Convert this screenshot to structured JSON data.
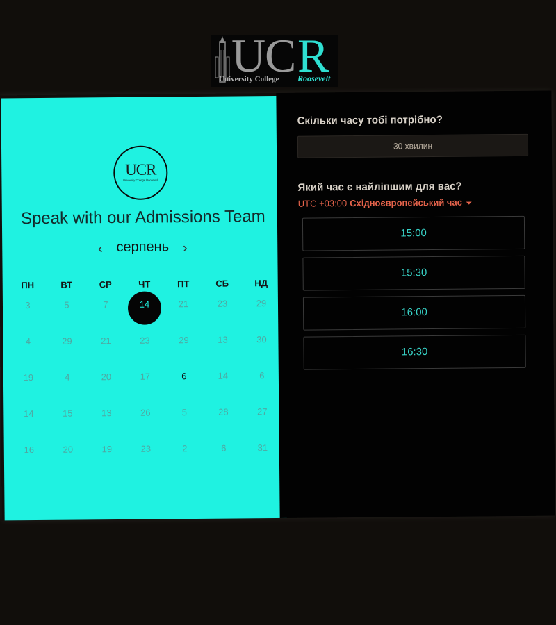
{
  "logo": {
    "letters_gray": [
      "U",
      "C"
    ],
    "letter_accent": "R",
    "subtitle": "University College",
    "subtitle_accent": "Roosevelt",
    "colors": {
      "accent": "#2fe0d2",
      "gray": "#9a9a9a"
    }
  },
  "scheduler": {
    "small_logo_text": "UCR",
    "small_logo_sub": "University College Roosevelt",
    "heading": "Speak with our Admissions Team",
    "month": "серпень",
    "nav": {
      "prev_icon": "chevron-left-icon",
      "next_icon": "chevron-right-icon",
      "prev_glyph": "‹",
      "next_glyph": "›"
    },
    "weekdays": [
      "ПН",
      "ВТ",
      "СР",
      "ЧТ",
      "ПТ",
      "СБ",
      "НД"
    ],
    "weeks": [
      [
        {
          "d": "3"
        },
        {
          "d": "5"
        },
        {
          "d": "7"
        },
        {
          "d": "14",
          "selected": true
        },
        {
          "d": "21"
        },
        {
          "d": "23"
        },
        {
          "d": "29"
        }
      ],
      [
        {
          "d": "4"
        },
        {
          "d": "29"
        },
        {
          "d": "21"
        },
        {
          "d": "23"
        },
        {
          "d": "29"
        },
        {
          "d": "13"
        },
        {
          "d": "30"
        }
      ],
      [
        {
          "d": "19"
        },
        {
          "d": "4"
        },
        {
          "d": "20"
        },
        {
          "d": "17"
        },
        {
          "d": "6",
          "available": true
        },
        {
          "d": "14"
        },
        {
          "d": "6"
        }
      ],
      [
        {
          "d": "14"
        },
        {
          "d": "15"
        },
        {
          "d": "13"
        },
        {
          "d": "26"
        },
        {
          "d": "5"
        },
        {
          "d": "28"
        },
        {
          "d": "27"
        }
      ],
      [
        {
          "d": "16"
        },
        {
          "d": "20"
        },
        {
          "d": "19"
        },
        {
          "d": "23"
        },
        {
          "d": "2"
        },
        {
          "d": "6"
        },
        {
          "d": "31"
        }
      ]
    ],
    "colors": {
      "panel": "#1ff2e1",
      "selected_bg": "#050505",
      "muted_day": "#4fa8a2"
    }
  },
  "booking": {
    "duration_question": "Скільки часу тобі потрібно?",
    "duration_value": "30 хвилин",
    "time_question": "Який час є найліпшим для вас?",
    "timezone_offset": "UTC +03:00",
    "timezone_name": "Східноєвропейський час",
    "timezone_icon": "caret-down-icon",
    "slots": [
      "15:00",
      "15:30",
      "16:00",
      "16:30"
    ],
    "colors": {
      "panel": "#020202",
      "slot_text": "#38d4c8",
      "timezone": "#e5634b"
    }
  }
}
